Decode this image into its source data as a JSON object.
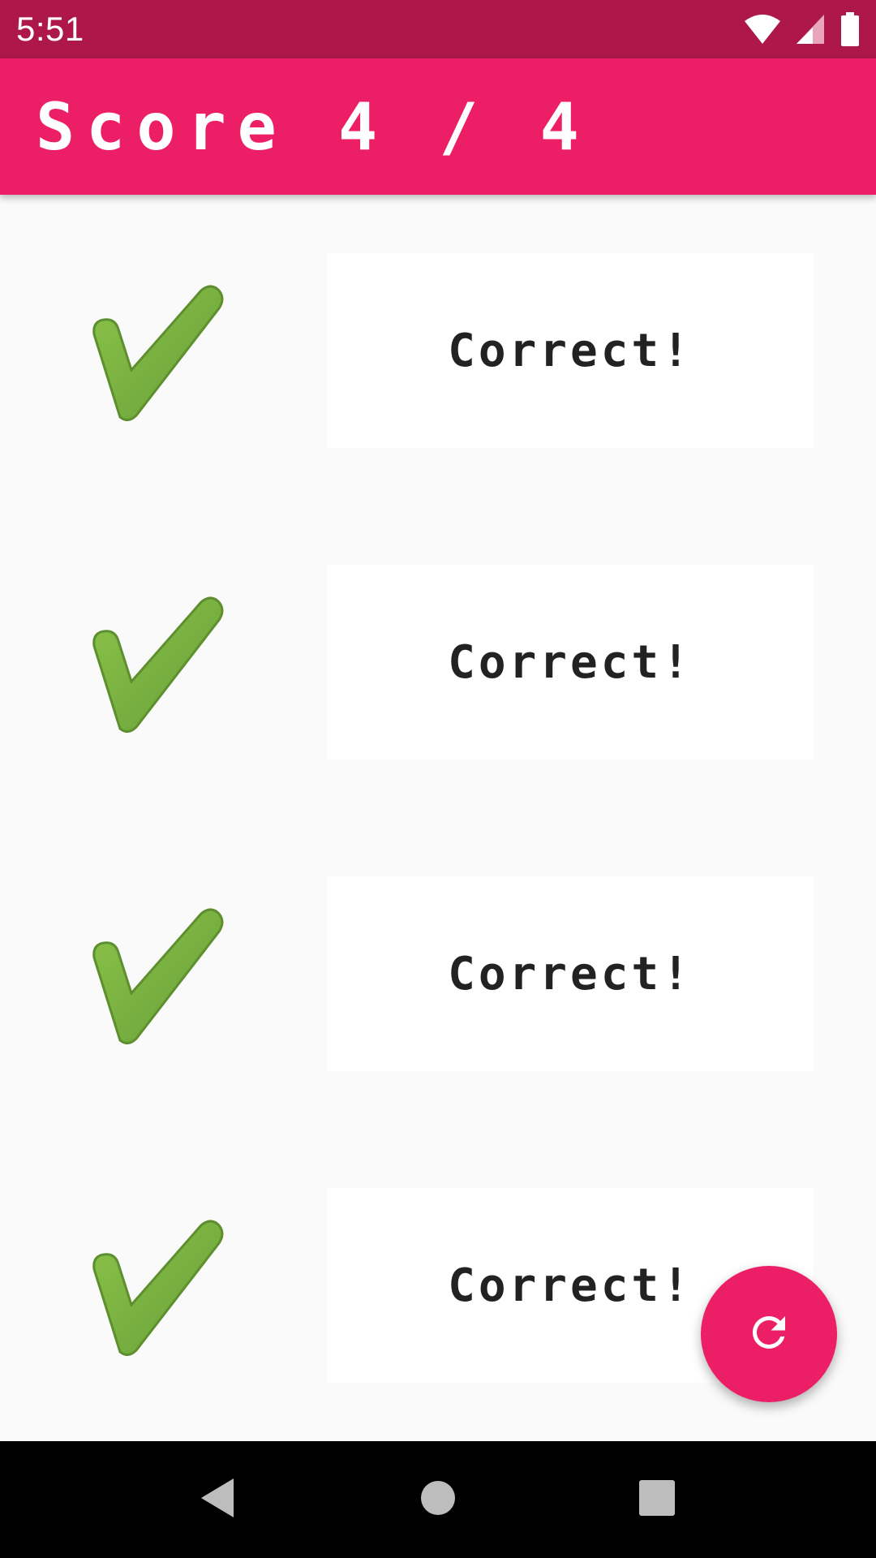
{
  "status_bar": {
    "time": "5:51",
    "icons": [
      "wifi-icon",
      "cellular-signal-icon",
      "battery-icon"
    ]
  },
  "app_bar": {
    "title": "Score 4 / 4",
    "background_color": "#ec1f66"
  },
  "results": [
    {
      "icon": "check-mark-icon",
      "text": "Correct!"
    },
    {
      "icon": "check-mark-icon",
      "text": "Correct!"
    },
    {
      "icon": "check-mark-icon",
      "text": "Correct!"
    },
    {
      "icon": "check-mark-icon",
      "text": "Correct!"
    }
  ],
  "fab": {
    "icon": "refresh-icon",
    "color": "#ec1f66"
  },
  "nav_bar": {
    "buttons": [
      "back-icon",
      "home-icon",
      "recents-icon"
    ]
  },
  "colors": {
    "status_bar": "#ad1749",
    "accent": "#ec1f66",
    "check_green": "#7cb342"
  }
}
